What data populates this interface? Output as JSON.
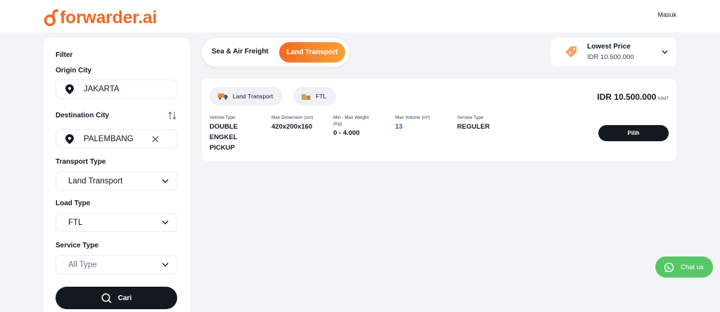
{
  "brand": {
    "name": "forwarder.ai",
    "color": "#f06a22"
  },
  "header": {
    "login_label": "Masuk"
  },
  "filter": {
    "title": "Filter",
    "origin_label": "Origin City",
    "origin_value": "JAKARTA",
    "destination_label": "Destination City",
    "destination_value": "PALEMBANG",
    "transport_label": "Transport Type",
    "transport_value": "Land Transport",
    "load_label": "Load Type",
    "load_value": "FTL",
    "service_label": "Service Type",
    "service_placeholder": "All Type",
    "search_label": "Cari"
  },
  "tabs": {
    "sea_air": "Sea & Air Freight",
    "land": "Land Transport",
    "active": "land"
  },
  "sort": {
    "title": "Lowest Price",
    "value": "IDR 10.500.000"
  },
  "result": {
    "chip_transport": "Land Transport",
    "chip_load": "FTL",
    "price": "IDR 10.500.000",
    "price_unit": "/UNIT",
    "columns": [
      {
        "label": "Vehicle Type",
        "value": "DOUBLE ENGKEL PICKUP"
      },
      {
        "label": "Max Dimension (cm)",
        "value": "420x200x160"
      },
      {
        "label": "Min - Max Weight (Kg)",
        "value": "0 - 4.000"
      },
      {
        "label": "Max Volume (m³)",
        "value": "13"
      },
      {
        "label": "Service Type",
        "value": "REGULER"
      }
    ],
    "select_label": "Pilih"
  },
  "chat": {
    "label": "Chat us"
  },
  "colors": {
    "accent": "#f06a22",
    "dark_button": "#14191f",
    "chat_green": "#58c667",
    "volume_blue": "#1d5fa6"
  }
}
